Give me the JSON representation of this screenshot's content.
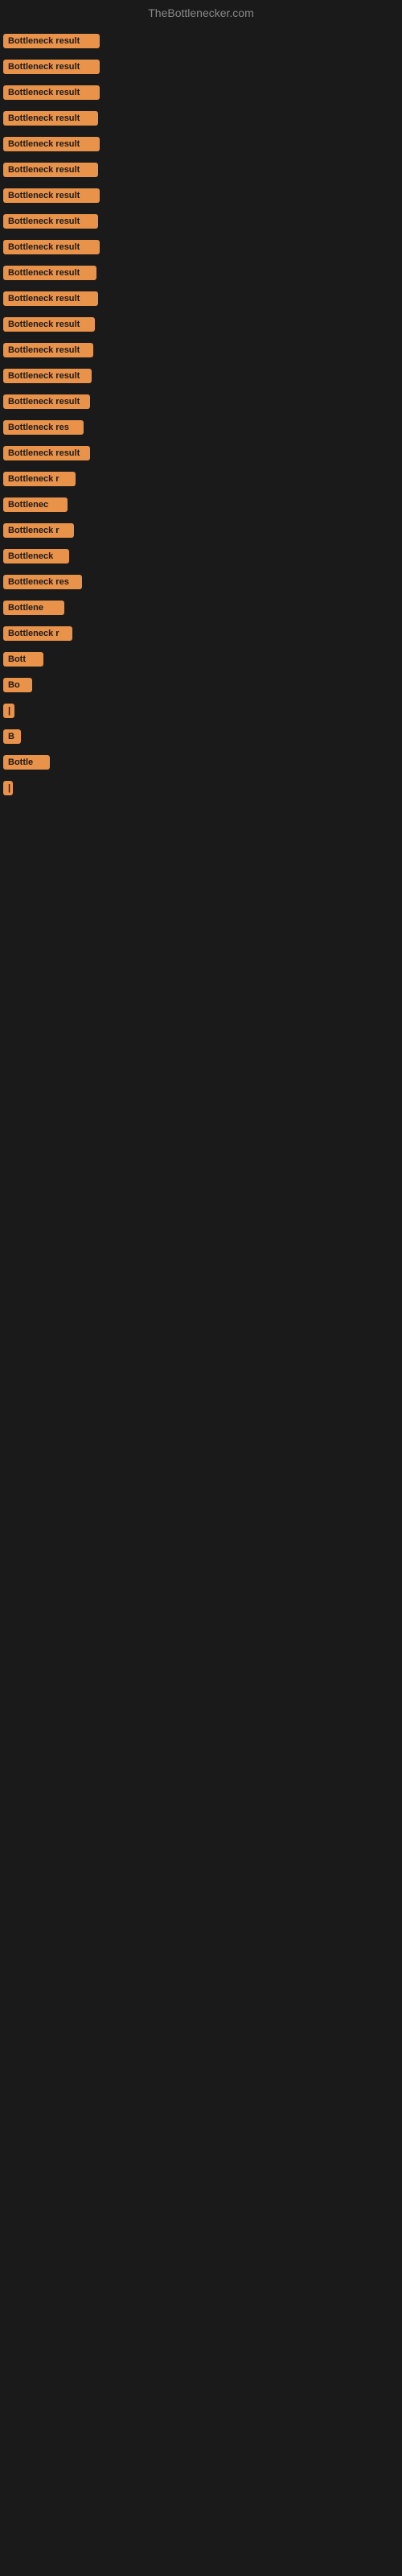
{
  "site": {
    "title": "TheBottlenecker.com"
  },
  "items": [
    {
      "label": "Bottleneck result",
      "width": 120
    },
    {
      "label": "Bottleneck result",
      "width": 120
    },
    {
      "label": "Bottleneck result",
      "width": 120
    },
    {
      "label": "Bottleneck result",
      "width": 118
    },
    {
      "label": "Bottleneck result",
      "width": 120
    },
    {
      "label": "Bottleneck result",
      "width": 118
    },
    {
      "label": "Bottleneck result",
      "width": 120
    },
    {
      "label": "Bottleneck result",
      "width": 118
    },
    {
      "label": "Bottleneck result",
      "width": 120
    },
    {
      "label": "Bottleneck result",
      "width": 116
    },
    {
      "label": "Bottleneck result",
      "width": 118
    },
    {
      "label": "Bottleneck result",
      "width": 114
    },
    {
      "label": "Bottleneck result",
      "width": 112
    },
    {
      "label": "Bottleneck result",
      "width": 110
    },
    {
      "label": "Bottleneck result",
      "width": 108
    },
    {
      "label": "Bottleneck res",
      "width": 100
    },
    {
      "label": "Bottleneck result",
      "width": 108
    },
    {
      "label": "Bottleneck r",
      "width": 90
    },
    {
      "label": "Bottlenec",
      "width": 80
    },
    {
      "label": "Bottleneck r",
      "width": 88
    },
    {
      "label": "Bottleneck",
      "width": 82
    },
    {
      "label": "Bottleneck res",
      "width": 98
    },
    {
      "label": "Bottlene",
      "width": 76
    },
    {
      "label": "Bottleneck r",
      "width": 86
    },
    {
      "label": "Bott",
      "width": 50
    },
    {
      "label": "Bo",
      "width": 36
    },
    {
      "label": "|",
      "width": 14
    },
    {
      "label": "B",
      "width": 22
    },
    {
      "label": "Bottle",
      "width": 58
    },
    {
      "label": "|",
      "width": 10
    }
  ]
}
